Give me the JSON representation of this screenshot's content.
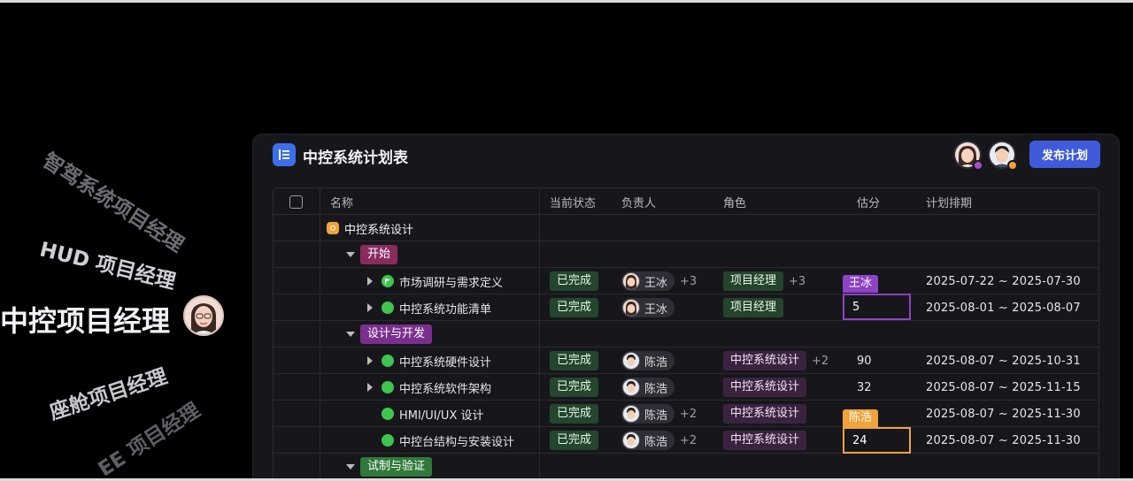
{
  "side_roles": [
    "智驾系统项目经理",
    "HUD 项目经理",
    "中控项目经理",
    "座舱项目经理",
    "EE 项目经理"
  ],
  "colors": {
    "accent": "#3f5bdc",
    "group_start": "#8a2b5e",
    "group_dev": "#7a2f8f",
    "group_test": "#2f7a3a",
    "status_done": "#3ec44f",
    "editor_wangbing": "#8d43c4",
    "editor_chenhao": "#f0a33a"
  },
  "header": {
    "title": "中控系统计划表",
    "publish_label": "发布计划",
    "app_icon": "list-tree-icon"
  },
  "columns": {
    "name": "名称",
    "status": "当前状态",
    "owner": "负责人",
    "role": "角色",
    "estimate": "估分",
    "schedule": "计划排期"
  },
  "project": {
    "name": "中控系统设计"
  },
  "groups": {
    "start": "开始",
    "dev": "设计与开发",
    "test": "试制与验证"
  },
  "tasks": [
    {
      "name": "市场调研与需求定义",
      "status": "已完成",
      "owner": "王冰",
      "owner_extra": "+3",
      "role": "项目经理",
      "role_extra": "+3",
      "estimate": "",
      "schedule": "2025-07-22 ~ 2025-07-30"
    },
    {
      "name": "中控系统功能清单",
      "status": "已完成",
      "owner": "王冰",
      "owner_extra": "",
      "role": "项目经理",
      "role_extra": "",
      "estimate": "5",
      "schedule": "2025-08-01 ~ 2025-08-07"
    },
    {
      "name": "中控系统硬件设计",
      "status": "已完成",
      "owner": "陈浩",
      "owner_extra": "",
      "role": "中控系统设计",
      "role_extra": "+2",
      "estimate": "90",
      "schedule": "2025-08-07 ~ 2025-10-31"
    },
    {
      "name": "中控系统软件架构",
      "status": "已完成",
      "owner": "陈浩",
      "owner_extra": "",
      "role": "中控系统设计",
      "role_extra": "",
      "estimate": "32",
      "schedule": "2025-08-07 ~ 2025-11-15"
    },
    {
      "name": "HMI/UI/UX 设计",
      "status": "已完成",
      "owner": "陈浩",
      "owner_extra": "+2",
      "role": "中控系统设计",
      "role_extra": "",
      "estimate": "",
      "schedule": "2025-08-07 ~ 2025-11-30"
    },
    {
      "name": "中控台结构与安装设计",
      "status": "已完成",
      "owner": "陈浩",
      "owner_extra": "+2",
      "role": "中控系统设计",
      "role_extra": "",
      "estimate": "24",
      "schedule": "2025-08-07 ~ 2025-11-30"
    }
  ],
  "editors": {
    "wangbing": "王冰",
    "chenhao": "陈浩"
  }
}
